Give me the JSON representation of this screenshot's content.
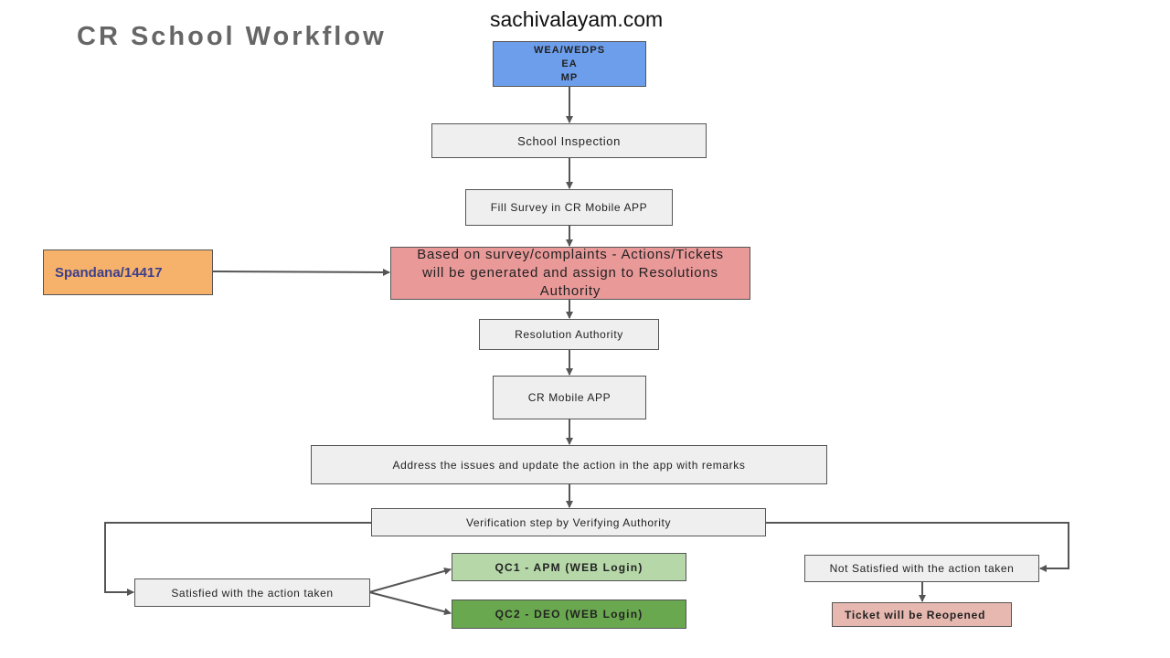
{
  "header": {
    "title": "CR School Workflow",
    "site": "sachivalayam.com"
  },
  "nodes": {
    "roles": [
      "WEA/WEDPS",
      "EA",
      "MP"
    ],
    "school_inspection": "School Inspection",
    "fill_survey": "Fill Survey in CR Mobile APP",
    "spandana": "Spandana/14417",
    "tickets": "Based on survey/complaints - Actions/Tickets will be generated and assign to Resolutions Authority",
    "resolution_authority": "Resolution Authority",
    "cr_mobile_app": "CR Mobile APP",
    "address_issues": "Address the issues and update the action in the app with remarks",
    "verification": "Verification step by Verifying Authority",
    "satisfied": "Satisfied with the action taken",
    "qc1": "QC1 - APM (WEB Login)",
    "qc2": "QC2 - DEO (WEB Login)",
    "not_satisfied": "Not Satisfied with the action taken",
    "reopened": "Ticket will be Reopened"
  },
  "colors": {
    "roles": "#6d9eeb",
    "spandana": "#f6b26b",
    "tickets": "#ea9999",
    "qc1": "#b6d7a8",
    "qc2": "#6aa84f",
    "reopened": "#e6b8af",
    "default": "#efefef"
  }
}
